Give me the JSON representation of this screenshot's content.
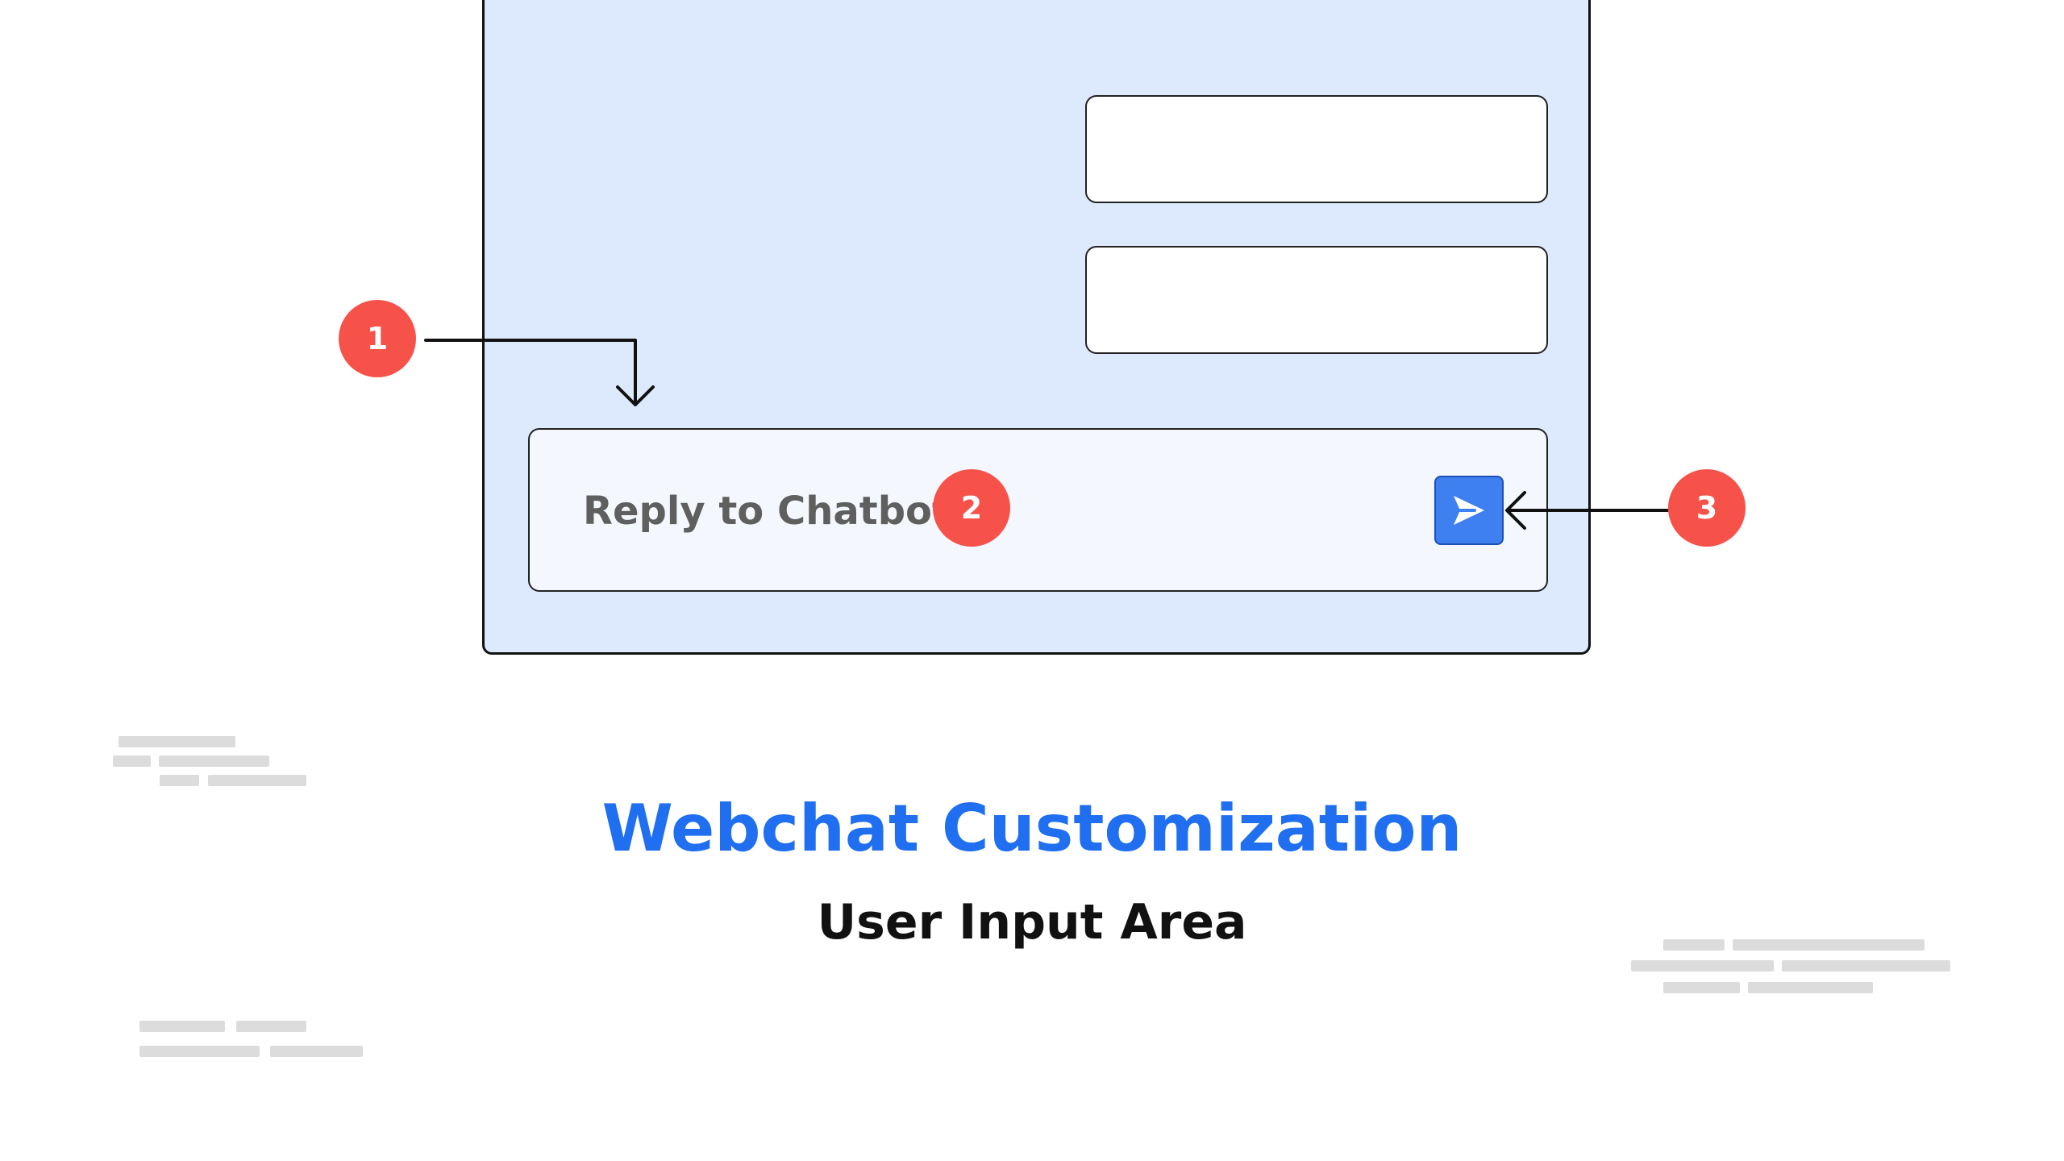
{
  "chat_window": {
    "input_placeholder": "Reply to Chatbot",
    "send_icon": "send-arrow-icon"
  },
  "callouts": [
    {
      "number": "1"
    },
    {
      "number": "2"
    },
    {
      "number": "3"
    }
  ],
  "heading": {
    "title": "Webchat Customization",
    "subtitle": "User Input Area"
  },
  "colors": {
    "accent_blue": "#1f6ff0",
    "window_background": "#dde9fd",
    "input_background": "#f4f8fe",
    "send_button": "#3f80f1",
    "callout_red": "#f7524a",
    "placeholder_gray": "#dcdcdc"
  }
}
